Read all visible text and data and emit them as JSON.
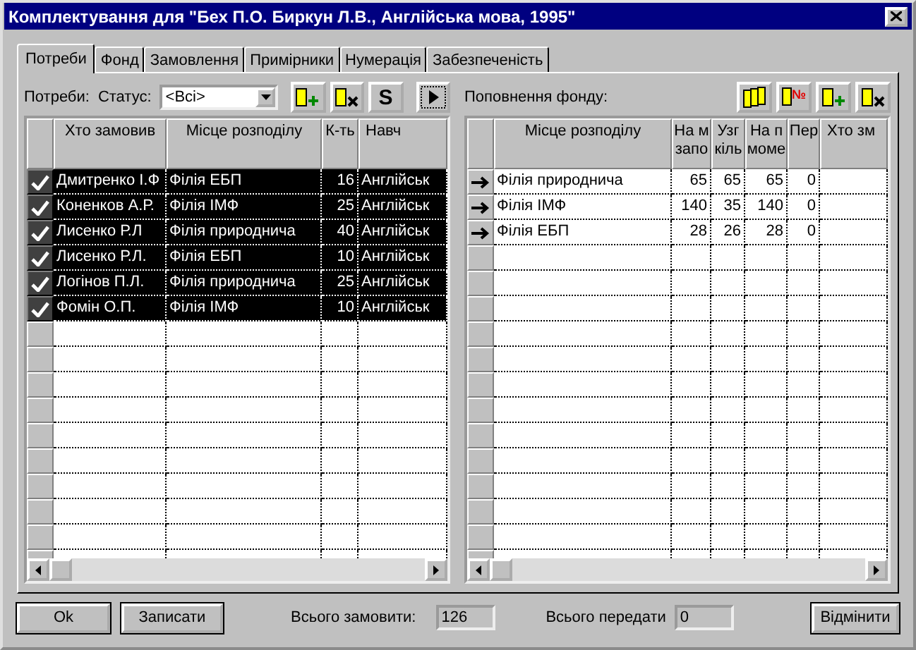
{
  "window": {
    "title": "Комплектування для \"Бех П.О. Биркун Л.В., Англійська мова, 1995\""
  },
  "tabs": [
    {
      "label": "Потреби",
      "selected": true
    },
    {
      "label": "Фонд",
      "selected": false
    },
    {
      "label": "Замовлення",
      "selected": false
    },
    {
      "label": "Примірники",
      "selected": false
    },
    {
      "label": "Нумерація",
      "selected": false
    },
    {
      "label": "Забезпеченість",
      "selected": false
    }
  ],
  "needs": {
    "label": "Потреби:",
    "status_label": "Статус:",
    "status_value": "<Всі>",
    "s_button": "S",
    "table": {
      "columns": [
        "Хто замовив",
        "Місце розподілу",
        "К-ть",
        "Навч"
      ],
      "rows": [
        {
          "selected": true,
          "cells": [
            "Дмитренко І.Ф",
            "Філія ЕБП",
            "16",
            "Англійськ"
          ]
        },
        {
          "selected": true,
          "cells": [
            "Коненков А.Р.",
            "Філія ІМФ",
            "25",
            "Англійськ"
          ]
        },
        {
          "selected": true,
          "cells": [
            "Лисенко Р.Л",
            "Філія природнича",
            "40",
            "Англійськ"
          ]
        },
        {
          "selected": true,
          "cells": [
            "Лисенко Р.Л.",
            "Філія ЕБП",
            "10",
            "Англійськ"
          ]
        },
        {
          "selected": true,
          "cells": [
            "Логінов П.Л.",
            "Філія природнича",
            "25",
            "Англійськ"
          ]
        },
        {
          "selected": true,
          "cells": [
            "Фомін О.П.",
            "Філія ІМФ",
            "10",
            "Англійськ"
          ]
        }
      ]
    }
  },
  "replenishment": {
    "label": "Поповнення фонду:",
    "number_badge": "№",
    "table": {
      "columns": [
        "Місце розподілу",
        "На м запо",
        "Узг кіль",
        "На п моме",
        "Пер",
        "Хто зм"
      ],
      "rows": [
        {
          "cells": [
            "Філія природнича",
            "65",
            "65",
            "65",
            "0",
            ""
          ]
        },
        {
          "cells": [
            "Філія ІМФ",
            "140",
            "35",
            "140",
            "0",
            ""
          ]
        },
        {
          "cells": [
            "Філія ЕБП",
            "28",
            "26",
            "28",
            "0",
            ""
          ]
        }
      ]
    }
  },
  "footer": {
    "ok": "Ok",
    "save": "Записати",
    "total_order_label": "Всього замовити:",
    "total_order": "126",
    "total_transfer_label": "Всього передати",
    "total_transfer": "0",
    "cancel": "Відмінити"
  }
}
